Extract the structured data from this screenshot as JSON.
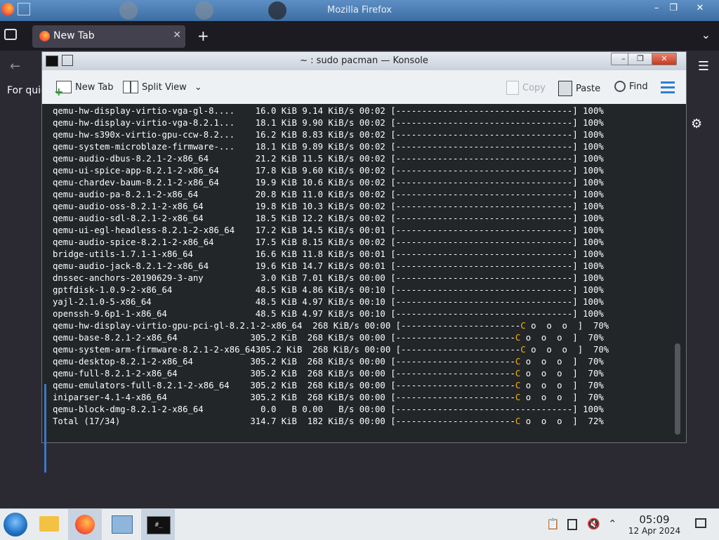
{
  "firefox": {
    "window_title": "Mozilla Firefox",
    "tab_label": "New Tab",
    "tab_close": "✕",
    "new_tab_glyph": "+",
    "list_tabs_glyph": "⌄",
    "menu_glyph": "☰",
    "back_glyph": "←",
    "quick_text": "For quic",
    "settings_glyph": "⚙",
    "minimize": "–",
    "maximize": "❐",
    "close": "✕"
  },
  "konsole": {
    "title": "~ : sudo pacman — Konsole",
    "toolbar": {
      "new_tab": "New Tab",
      "split_view": "Split View",
      "split_view_arrow": "⌄",
      "copy": "Copy",
      "paste": "Paste",
      "find": "Find"
    },
    "terminal_lines": [
      {
        "pkg": "qemu-hw-display-virtio-vga-gl-8....",
        "size": "16.0 KiB",
        "rate": "9.14 KiB/s",
        "time": "00:02",
        "bar": "----------------------------------",
        "tail": "",
        "pct": "100%"
      },
      {
        "pkg": "qemu-hw-display-virtio-vga-8.2.1...",
        "size": "18.1 KiB",
        "rate": "9.90 KiB/s",
        "time": "00:02",
        "bar": "----------------------------------",
        "tail": "",
        "pct": "100%"
      },
      {
        "pkg": "qemu-hw-s390x-virtio-gpu-ccw-8.2...",
        "size": "16.2 KiB",
        "rate": "8.83 KiB/s",
        "time": "00:02",
        "bar": "----------------------------------",
        "tail": "",
        "pct": "100%"
      },
      {
        "pkg": "qemu-system-microblaze-firmware-...",
        "size": "18.1 KiB",
        "rate": "9.89 KiB/s",
        "time": "00:02",
        "bar": "----------------------------------",
        "tail": "",
        "pct": "100%"
      },
      {
        "pkg": "qemu-audio-dbus-8.2.1-2-x86_64",
        "size": "21.2 KiB",
        "rate": "11.5 KiB/s",
        "time": "00:02",
        "bar": "----------------------------------",
        "tail": "",
        "pct": "100%"
      },
      {
        "pkg": "qemu-ui-spice-app-8.2.1-2-x86_64",
        "size": "17.8 KiB",
        "rate": "9.60 KiB/s",
        "time": "00:02",
        "bar": "----------------------------------",
        "tail": "",
        "pct": "100%"
      },
      {
        "pkg": "qemu-chardev-baum-8.2.1-2-x86_64",
        "size": "19.9 KiB",
        "rate": "10.6 KiB/s",
        "time": "00:02",
        "bar": "----------------------------------",
        "tail": "",
        "pct": "100%"
      },
      {
        "pkg": "qemu-audio-pa-8.2.1-2-x86_64",
        "size": "20.8 KiB",
        "rate": "11.0 KiB/s",
        "time": "00:02",
        "bar": "----------------------------------",
        "tail": "",
        "pct": "100%"
      },
      {
        "pkg": "qemu-audio-oss-8.2.1-2-x86_64",
        "size": "19.8 KiB",
        "rate": "10.3 KiB/s",
        "time": "00:02",
        "bar": "----------------------------------",
        "tail": "",
        "pct": "100%"
      },
      {
        "pkg": "qemu-audio-sdl-8.2.1-2-x86_64",
        "size": "18.5 KiB",
        "rate": "12.2 KiB/s",
        "time": "00:02",
        "bar": "----------------------------------",
        "tail": "",
        "pct": "100%"
      },
      {
        "pkg": "qemu-ui-egl-headless-8.2.1-2-x86_64",
        "size": "17.2 KiB",
        "rate": "14.5 KiB/s",
        "time": "00:01",
        "bar": "----------------------------------",
        "tail": "",
        "pct": "100%"
      },
      {
        "pkg": "qemu-audio-spice-8.2.1-2-x86_64",
        "size": "17.5 KiB",
        "rate": "8.15 KiB/s",
        "time": "00:02",
        "bar": "----------------------------------",
        "tail": "",
        "pct": "100%"
      },
      {
        "pkg": "bridge-utils-1.7.1-1-x86_64",
        "size": "16.6 KiB",
        "rate": "11.8 KiB/s",
        "time": "00:01",
        "bar": "----------------------------------",
        "tail": "",
        "pct": "100%"
      },
      {
        "pkg": "qemu-audio-jack-8.2.1-2-x86_64",
        "size": "19.6 KiB",
        "rate": "14.7 KiB/s",
        "time": "00:01",
        "bar": "----------------------------------",
        "tail": "",
        "pct": "100%"
      },
      {
        "pkg": "dnssec-anchors-20190629-3-any",
        "size": " 3.0 KiB",
        "rate": "7.01 KiB/s",
        "time": "00:00",
        "bar": "----------------------------------",
        "tail": "",
        "pct": "100%"
      },
      {
        "pkg": "gptfdisk-1.0.9-2-x86_64",
        "size": "48.5 KiB",
        "rate": "4.86 KiB/s",
        "time": "00:10",
        "bar": "----------------------------------",
        "tail": "",
        "pct": "100%"
      },
      {
        "pkg": "yajl-2.1.0-5-x86_64",
        "size": "48.5 KiB",
        "rate": "4.97 KiB/s",
        "time": "00:10",
        "bar": "----------------------------------",
        "tail": "",
        "pct": "100%"
      },
      {
        "pkg": "openssh-9.6p1-1-x86_64",
        "size": "48.5 KiB",
        "rate": "4.97 KiB/s",
        "time": "00:10",
        "bar": "----------------------------------",
        "tail": "",
        "pct": "100%"
      },
      {
        "pkg": "qemu-hw-display-virtio-gpu-pci-gl-8.2.1-2-x86_64",
        "size": "",
        "rate": "268 KiB/s",
        "time": "00:00",
        "bar": "-----------------------",
        "tail": " o  o  o  ",
        "pct": " 70%"
      },
      {
        "pkg": "qemu-base-8.2.1-2-x86_64",
        "size": "305.2 KiB",
        "rate": "268 KiB/s",
        "time": "00:00",
        "bar": "-----------------------",
        "tail": " o  o  o  ",
        "pct": " 70%"
      },
      {
        "pkg": "qemu-system-arm-firmware-8.2.1-2-x86_64",
        "size": "305.2 KiB",
        "rate": "268 KiB/s",
        "time": "00:00",
        "bar": "-----------------------",
        "tail": " o  o  o  ",
        "pct": " 70%"
      },
      {
        "pkg": "qemu-desktop-8.2.1-2-x86_64",
        "size": "305.2 KiB",
        "rate": "268 KiB/s",
        "time": "00:00",
        "bar": "-----------------------",
        "tail": " o  o  o  ",
        "pct": " 70%"
      },
      {
        "pkg": "qemu-full-8.2.1-2-x86_64",
        "size": "305.2 KiB",
        "rate": "268 KiB/s",
        "time": "00:00",
        "bar": "-----------------------",
        "tail": " o  o  o  ",
        "pct": " 70%"
      },
      {
        "pkg": "qemu-emulators-full-8.2.1-2-x86_64",
        "size": "305.2 KiB",
        "rate": "268 KiB/s",
        "time": "00:00",
        "bar": "-----------------------",
        "tail": " o  o  o  ",
        "pct": " 70%"
      },
      {
        "pkg": "iniparser-4.1-4-x86_64",
        "size": "305.2 KiB",
        "rate": "268 KiB/s",
        "time": "00:00",
        "bar": "-----------------------",
        "tail": " o  o  o  ",
        "pct": " 70%"
      },
      {
        "pkg": "qemu-block-dmg-8.2.1-2-x86_64",
        "size": "  0.0   B",
        "rate": "0.00   B/s",
        "time": "00:00",
        "bar": "----------------------------------",
        "tail": "",
        "pct": "100%"
      },
      {
        "pkg": "Total (17/34)",
        "size": "314.7 KiB",
        "rate": "182 KiB/s",
        "time": "00:00",
        "bar": "-----------------------",
        "tail": " o  o  o  ",
        "pct": " 72%"
      }
    ],
    "progress_head_char": "C",
    "progress_head_color": "#f6b100"
  },
  "taskbar": {
    "term_icon_text": "#_",
    "clock_time": "05:09",
    "clock_date": "12 Apr 2024",
    "tray": {
      "clipboard": "📋",
      "volume": "🔇",
      "expand": "⌃"
    }
  }
}
